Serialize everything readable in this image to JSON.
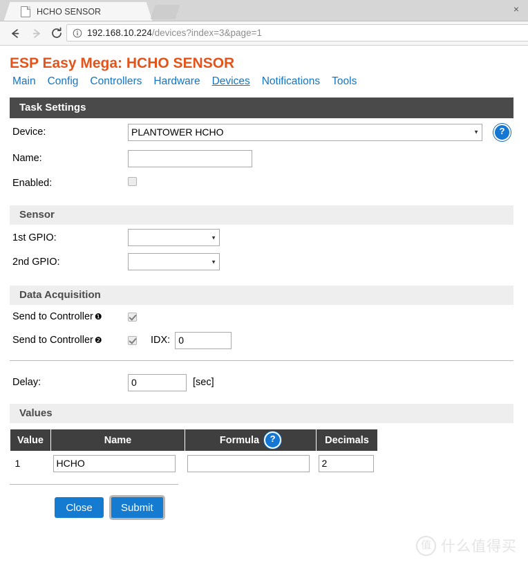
{
  "browser": {
    "tab": {
      "title": "HCHO SENSOR",
      "favicon": "page-icon",
      "close_label": "×"
    },
    "newtab_label": "",
    "nav": {
      "back": "back-arrow",
      "forward": "forward-arrow",
      "reload": "reload-arrow"
    },
    "address": {
      "security_icon": "info-circle-icon",
      "host": "192.168.10.224",
      "path": "/devices?index=3&page=1"
    }
  },
  "page": {
    "title": "ESP Easy Mega: HCHO SENSOR",
    "title_color": "#e4541a",
    "link_color": "#1275c8",
    "nav_items": [
      {
        "label": "Main",
        "active": false
      },
      {
        "label": "Config",
        "active": false
      },
      {
        "label": "Controllers",
        "active": false
      },
      {
        "label": "Hardware",
        "active": false
      },
      {
        "label": "Devices",
        "active": true
      },
      {
        "label": "Notifications",
        "active": false
      },
      {
        "label": "Tools",
        "active": false
      }
    ],
    "task_settings": {
      "heading": "Task Settings",
      "device": {
        "label": "Device:",
        "value": "PLANTOWER HCHO",
        "help": "?"
      },
      "name": {
        "label": "Name:",
        "value": "",
        "placeholder": ""
      },
      "enabled": {
        "label": "Enabled:",
        "checked": false
      }
    },
    "sensor": {
      "heading": "Sensor",
      "gpio1": {
        "label": "1st GPIO:",
        "value": ""
      },
      "gpio2": {
        "label": "2nd GPIO:",
        "value": ""
      }
    },
    "data_acquisition": {
      "heading": "Data Acquisition",
      "controller1": {
        "label": "Send to Controller",
        "number": "❶",
        "checked": true
      },
      "controller2": {
        "label": "Send to Controller",
        "number": "❷",
        "checked": true,
        "idx_label": "IDX:",
        "idx_value": "0"
      }
    },
    "delay": {
      "label": "Delay:",
      "value": "0",
      "unit": "[sec]"
    },
    "values": {
      "heading": "Values",
      "columns": [
        "Value",
        "Name",
        "Formula",
        "Decimals"
      ],
      "formula_help": "?",
      "rows": [
        {
          "index": "1",
          "name": "HCHO",
          "formula": "",
          "decimals": "2"
        }
      ]
    },
    "buttons": {
      "close": "Close",
      "submit": "Submit",
      "accent_color": "#147bd1"
    }
  },
  "watermark": {
    "logo": "值",
    "text": "什么值得买"
  }
}
